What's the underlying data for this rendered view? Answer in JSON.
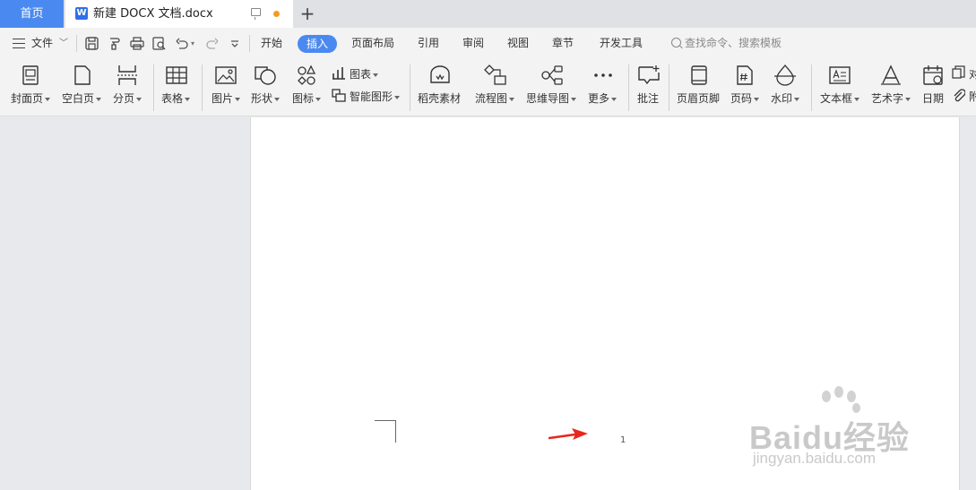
{
  "tabs": {
    "home_label": "首页",
    "doc_title": "新建 DOCX 文档.docx",
    "doc_icon_letter": "W",
    "add_label": "+"
  },
  "menu": {
    "file_label": "文件",
    "items": [
      "开始",
      "插入",
      "页面布局",
      "引用",
      "审阅",
      "视图",
      "章节",
      "开发工具"
    ],
    "active_item": "插入",
    "search_placeholder": "查找命令、搜索模板"
  },
  "ribbon": {
    "items": [
      {
        "label": "封面页",
        "icon": "cover-page-icon",
        "dropdown": true
      },
      {
        "label": "空白页",
        "icon": "blank-page-icon",
        "dropdown": true
      },
      {
        "label": "分页",
        "icon": "page-break-icon",
        "dropdown": true
      },
      {
        "label": "表格",
        "icon": "table-icon",
        "dropdown": true
      },
      {
        "label": "图片",
        "icon": "picture-icon",
        "dropdown": true
      },
      {
        "label": "形状",
        "icon": "shape-icon",
        "dropdown": true
      },
      {
        "label": "图标",
        "icon": "icons-icon",
        "dropdown": true
      },
      {
        "label": "图表",
        "icon": "chart-icon",
        "dropdown": true
      },
      {
        "label": "智能图形",
        "icon": "smartart-icon",
        "dropdown": true
      },
      {
        "label": "稻壳素材",
        "icon": "docer-icon",
        "dropdown": false
      },
      {
        "label": "流程图",
        "icon": "flowchart-icon",
        "dropdown": true
      },
      {
        "label": "思维导图",
        "icon": "mindmap-icon",
        "dropdown": true
      },
      {
        "label": "更多",
        "icon": "more-icon",
        "dropdown": true
      },
      {
        "label": "批注",
        "icon": "comment-icon",
        "dropdown": false
      },
      {
        "label": "页眉页脚",
        "icon": "header-footer-icon",
        "dropdown": false
      },
      {
        "label": "页码",
        "icon": "page-number-icon",
        "dropdown": true
      },
      {
        "label": "水印",
        "icon": "watermark-icon",
        "dropdown": true
      },
      {
        "label": "文本框",
        "icon": "textbox-icon",
        "dropdown": true
      },
      {
        "label": "艺术字",
        "icon": "wordart-icon",
        "dropdown": true
      },
      {
        "label": "日期",
        "icon": "date-icon",
        "dropdown": false
      },
      {
        "label": "对",
        "icon": "object-icon",
        "dropdown": false
      },
      {
        "label": "附",
        "icon": "attachment-icon",
        "dropdown": false
      }
    ]
  },
  "document": {
    "page_number": "1"
  },
  "watermark": {
    "brand": "Baidu经验",
    "url": "jingyan.baidu.com"
  },
  "colors": {
    "accent": "#4a8af0",
    "arrow": "#e8281c",
    "modified_dot": "#f29c1f"
  }
}
